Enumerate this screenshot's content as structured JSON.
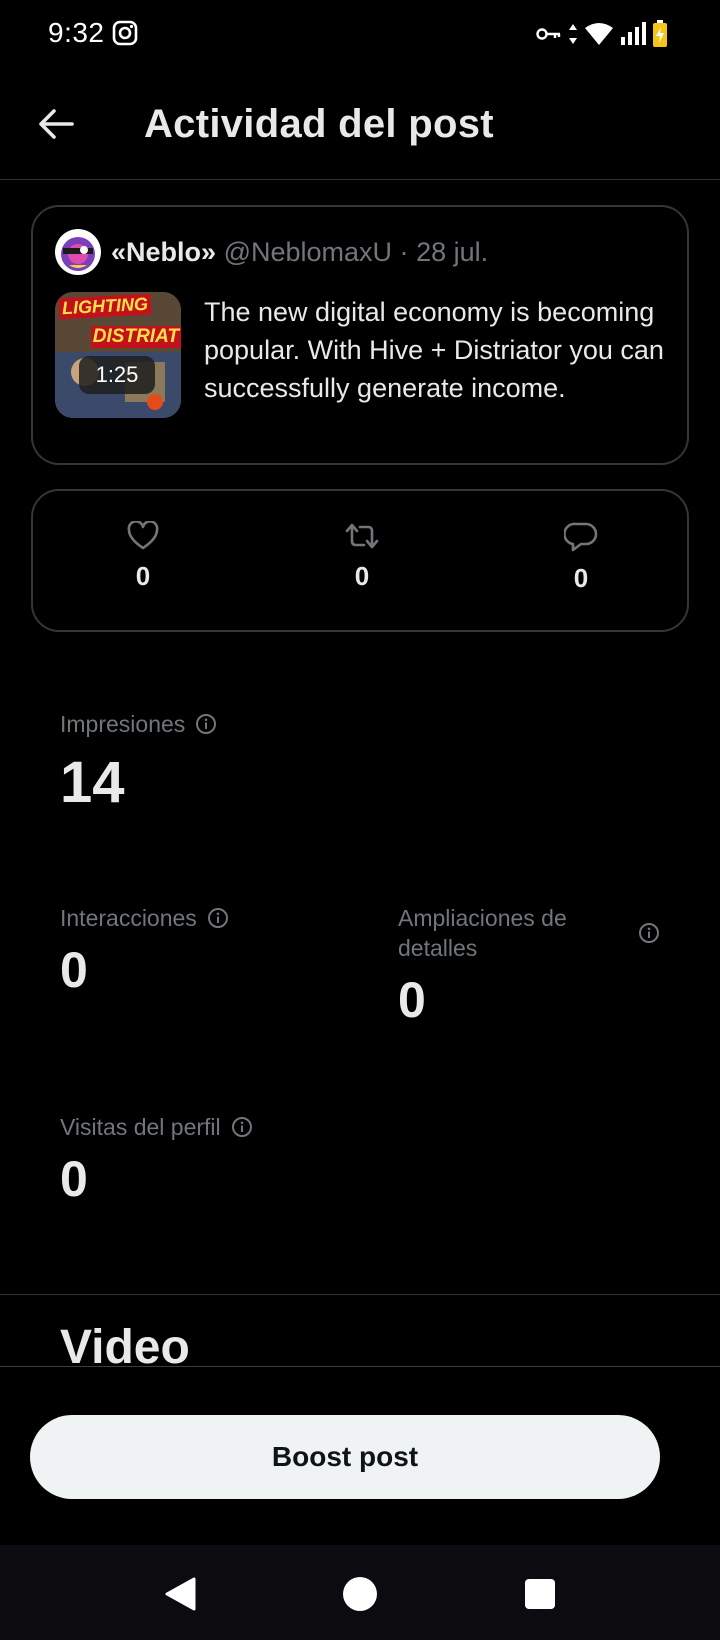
{
  "status_bar": {
    "time": "9:32",
    "icons": [
      "instagram-icon",
      "vpn-key-icon",
      "wifi-icon",
      "signal-icon",
      "battery-icon"
    ]
  },
  "header": {
    "title": "Actividad del post"
  },
  "post": {
    "author_name": "«Neblo»",
    "handle": "@NeblomaxU",
    "separator": "·",
    "date": "28 jul.",
    "thumbnail_text_1": "LIGHTING",
    "thumbnail_text_2": "DISTRIAT",
    "video_duration": "1:25",
    "text": "The new digital economy is becoming popular. With Hive + Distriator you can successfully generate income."
  },
  "engagement": {
    "likes": "0",
    "reposts": "0",
    "replies": "0"
  },
  "metrics": {
    "impressions_label": "Impresiones",
    "impressions_value": "14",
    "interactions_label": "Interacciones",
    "interactions_value": "0",
    "detail_expands_label": "Ampliaciones de detalles",
    "detail_expands_value": "0",
    "profile_visits_label": "Visitas del perfil",
    "profile_visits_value": "0"
  },
  "video_section": {
    "heading": "Video"
  },
  "boost_button": {
    "label": "Boost post"
  },
  "colors": {
    "background": "#000000",
    "text_primary": "#e7e9ea",
    "text_secondary": "#71767b",
    "border": "#333639",
    "button_bg": "#eff3f4"
  }
}
